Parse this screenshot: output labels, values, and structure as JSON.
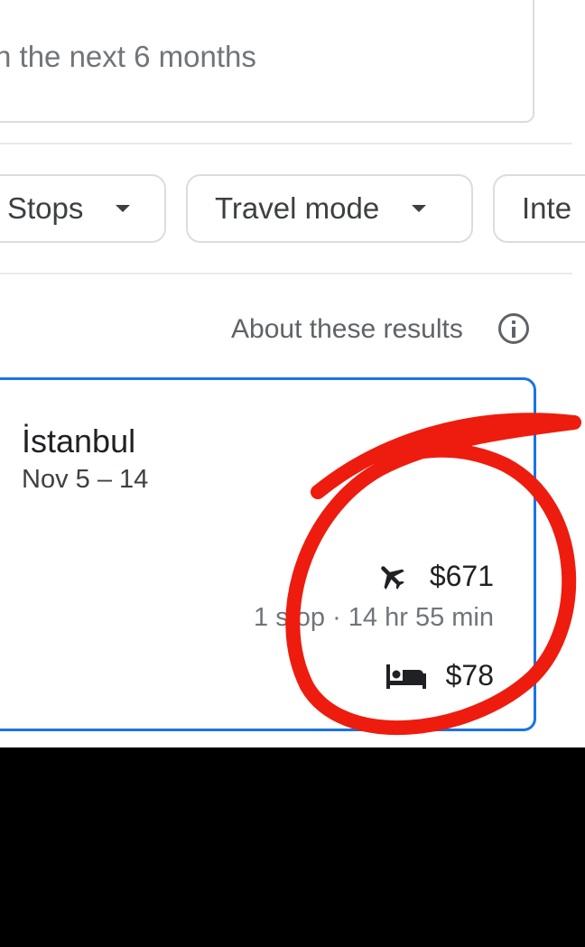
{
  "search": {
    "date_text": "n the next 6 months"
  },
  "filters": [
    {
      "label": "Stops"
    },
    {
      "label": "Travel mode"
    },
    {
      "label": "Inte"
    }
  ],
  "results_info": {
    "label": "About these results",
    "icon": "info-icon"
  },
  "result_card": {
    "city": "İstanbul",
    "dates": "Nov 5 – 14",
    "flight": {
      "icon": "airplane-icon",
      "price": "$671",
      "details": "1 stop · 14 hr 55 min"
    },
    "hotel": {
      "icon": "bed-icon",
      "price": "$78"
    }
  },
  "colors": {
    "card_border": "#1a73e8",
    "annotation": "#ee1c0e",
    "bottom_bar": "#000000"
  }
}
